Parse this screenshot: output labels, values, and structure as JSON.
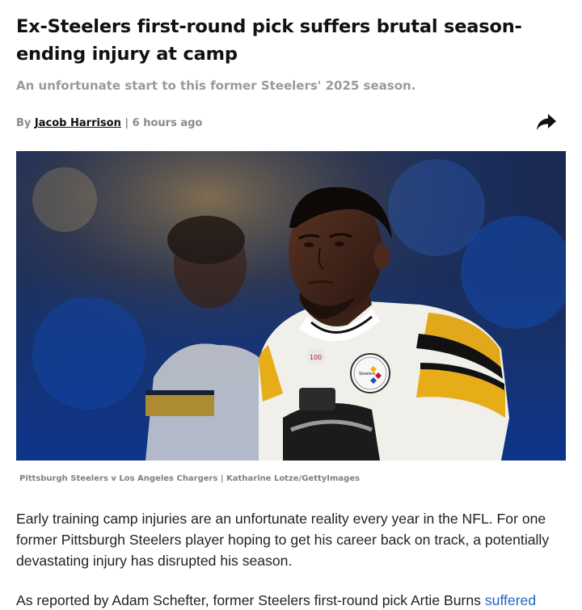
{
  "article": {
    "headline": "Ex-Steelers first-round pick suffers brutal season-ending injury at camp",
    "subheadline": "An unfortunate start to this former Steelers' 2025 season.",
    "byline": {
      "prefix": "By",
      "author": "Jacob Harrison",
      "separator": "|",
      "time": "6 hours ago"
    },
    "share_icon": "share-arrow-icon",
    "image_caption": "Pittsburgh Steelers v Los Angeles Chargers | Katharine Lotze/GettyImages",
    "paragraphs": [
      "Early training camp injuries are an unfortunate reality every year in the NFL. For one former Pittsburgh Steelers player hoping to get his career back on track, a potentially devastating injury has disrupted his season."
    ],
    "p2_text": "As reported by Adam Schefter, former Steelers first-round pick Artie Burns ",
    "p2_link": "suffered"
  },
  "colors": {
    "headline": "#111111",
    "muted": "#9a9a9a",
    "link": "#1f63c6",
    "steelers_gold": "#f2b400"
  }
}
